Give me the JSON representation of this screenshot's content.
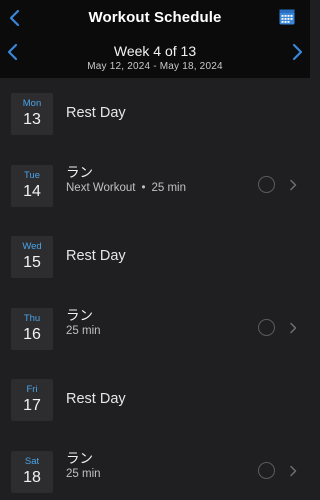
{
  "header": {
    "title": "Workout Schedule",
    "back_icon": "chevron-left-icon",
    "calendar_icon": "calendar-icon",
    "accent_color": "#3a86d9"
  },
  "week": {
    "title": "Week 4 of 13",
    "range": "May 12, 2024 - May 18, 2024"
  },
  "days": [
    {
      "dow": "Mon",
      "day": "13",
      "type": "rest",
      "label": "Rest Day"
    },
    {
      "dow": "Tue",
      "day": "14",
      "type": "workout",
      "name": "ラン",
      "status": "Next Workout",
      "duration": "25 min"
    },
    {
      "dow": "Wed",
      "day": "15",
      "type": "rest",
      "label": "Rest Day"
    },
    {
      "dow": "Thu",
      "day": "16",
      "type": "workout",
      "name": "ラン",
      "duration": "25 min"
    },
    {
      "dow": "Fri",
      "day": "17",
      "type": "rest",
      "label": "Rest Day"
    },
    {
      "dow": "Sat",
      "day": "18",
      "type": "workout",
      "name": "ラン",
      "duration": "25 min"
    }
  ]
}
